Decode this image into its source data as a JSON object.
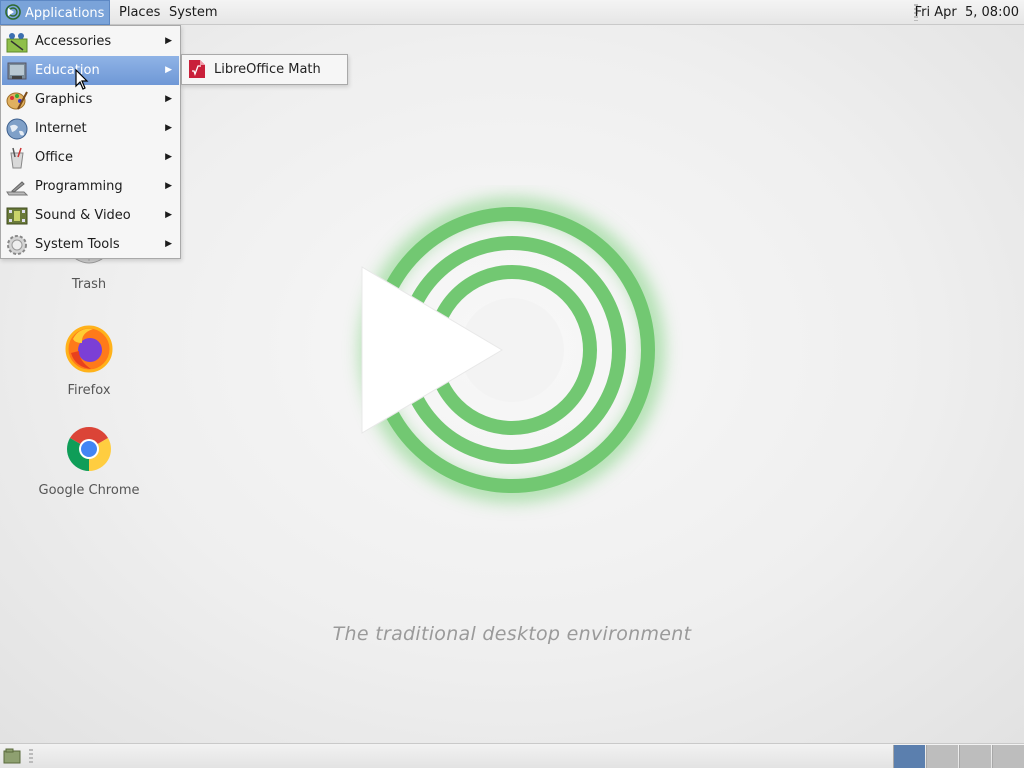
{
  "top_panel": {
    "menu": {
      "applications": "Applications",
      "places": "Places",
      "system": "System"
    },
    "clock": "Fri Apr  5, 08:00"
  },
  "apps_menu": {
    "items": [
      {
        "label": "Accessories",
        "icon": "accessories-icon"
      },
      {
        "label": "Education",
        "icon": "education-icon",
        "active": true
      },
      {
        "label": "Graphics",
        "icon": "graphics-icon"
      },
      {
        "label": "Internet",
        "icon": "internet-icon"
      },
      {
        "label": "Office",
        "icon": "office-icon"
      },
      {
        "label": "Programming",
        "icon": "programming-icon"
      },
      {
        "label": "Sound & Video",
        "icon": "sound-video-icon"
      },
      {
        "label": "System Tools",
        "icon": "system-tools-icon"
      }
    ],
    "submenu_arrow": "▶"
  },
  "education_submenu": {
    "items": [
      {
        "label": "LibreOffice Math",
        "icon": "libreoffice-math-icon"
      }
    ]
  },
  "desktop": {
    "icons": [
      {
        "label": "Trash",
        "icon": "trash-icon"
      },
      {
        "label": "Firefox",
        "icon": "firefox-icon"
      },
      {
        "label": "Google Chrome",
        "icon": "chrome-icon"
      }
    ],
    "tagline": "The traditional desktop environment"
  },
  "bottom_panel": {
    "workspaces_active_index": 0,
    "workspace_count": 4
  },
  "colors": {
    "menu_highlight": "#7aa3d9",
    "mate_green": "#6cc56f",
    "active_workspace": "#5b7fae"
  }
}
